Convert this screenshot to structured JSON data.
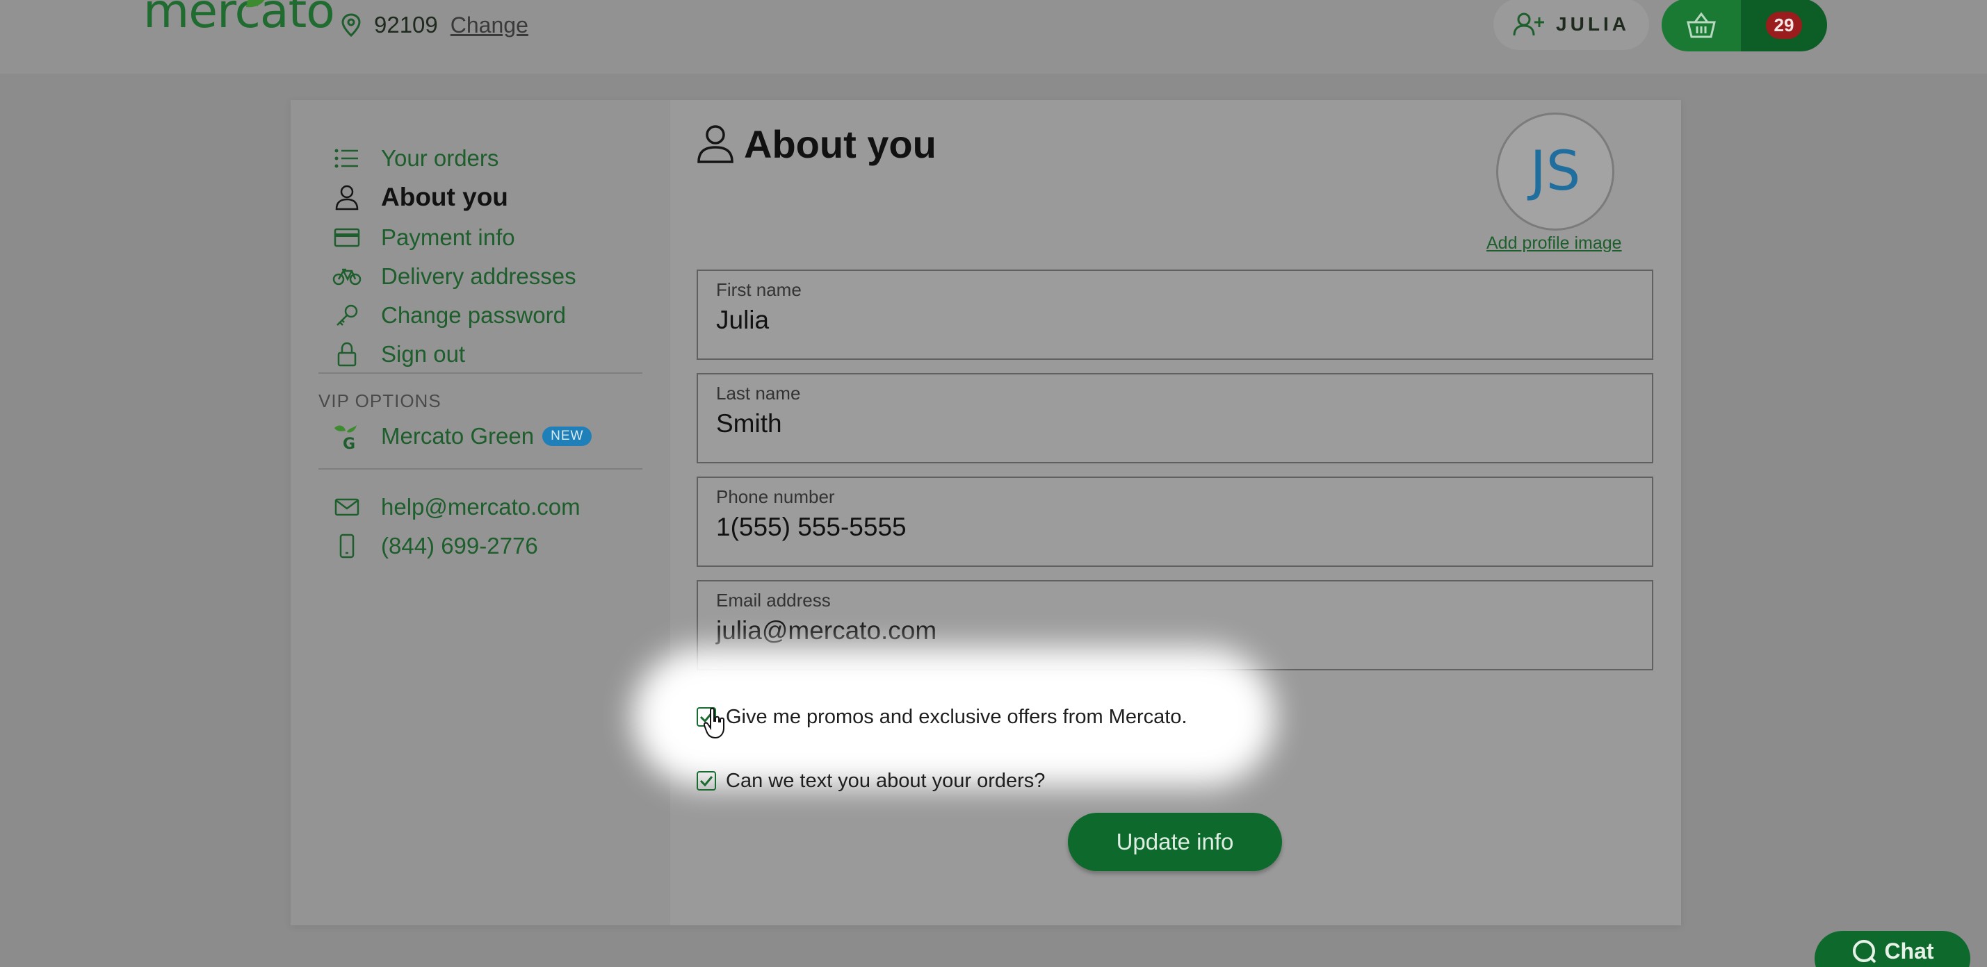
{
  "header": {
    "logo": "mercato",
    "zip": "92109",
    "change_label": "Change",
    "user_name": "JULIA",
    "cart_count": "29"
  },
  "sidebar": {
    "items": [
      {
        "label": "Your orders",
        "icon": "list-icon"
      },
      {
        "label": "About you",
        "icon": "user-icon",
        "active": true
      },
      {
        "label": "Payment info",
        "icon": "credit-card-icon"
      },
      {
        "label": "Delivery addresses",
        "icon": "bicycle-icon"
      },
      {
        "label": "Change password",
        "icon": "key-icon"
      },
      {
        "label": "Sign out",
        "icon": "lock-icon"
      }
    ],
    "vip_heading": "VIP OPTIONS",
    "vip_item": {
      "label": "Mercato Green",
      "badge": "NEW",
      "icon": "mercato-green-logo-icon"
    },
    "contact": [
      {
        "label": "help@mercato.com",
        "icon": "envelope-icon"
      },
      {
        "label": "(844) 699-2776",
        "icon": "phone-icon"
      }
    ]
  },
  "main": {
    "title": "About you",
    "avatar_initials": "JS",
    "add_image_label": "Add profile image",
    "fields": [
      {
        "label": "First name",
        "value": "Julia"
      },
      {
        "label": "Last name",
        "value": "Smith"
      },
      {
        "label": "Phone number",
        "value": "1(555) 555-5555"
      },
      {
        "label": "Email address",
        "value": "julia@mercato.com"
      }
    ],
    "checkboxes": [
      {
        "label": "Give me promos and exclusive offers from Mercato.",
        "checked": true
      },
      {
        "label": "Can we text you about your orders?",
        "checked": true
      }
    ],
    "update_label": "Update info"
  },
  "chat_label": "Chat",
  "colors": {
    "brand_green": "#1a7a34",
    "dark_green": "#0d5e26",
    "badge_red": "#9b1c1c",
    "new_badge_blue": "#1f7fb8",
    "avatar_blue": "#1f6e9e"
  }
}
